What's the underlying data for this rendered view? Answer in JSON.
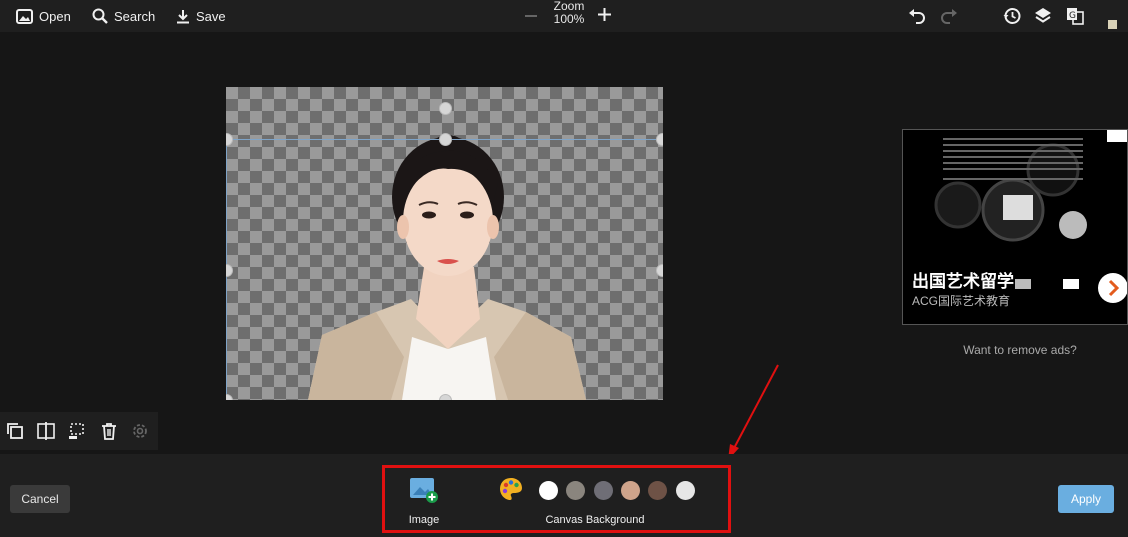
{
  "toolbar": {
    "open_label": "Open",
    "search_label": "Search",
    "save_label": "Save",
    "zoom_title": "Zoom",
    "zoom_value": "100%"
  },
  "icons": [
    "open-image-icon",
    "search-icon",
    "download-icon",
    "minus-icon",
    "plus-icon",
    "undo-icon",
    "redo-icon",
    "history-icon",
    "layers-icon",
    "translate-icon",
    "duplicate-icon",
    "flip-icon",
    "crop-icon",
    "trash-icon",
    "gear-icon",
    "add-image-icon",
    "palette-icon",
    "chevron-right-icon"
  ],
  "ad": {
    "title": "出国艺术留学",
    "subtitle": "ACG国际艺术教育",
    "remove_ads": "Want to remove ads?"
  },
  "bottom": {
    "cancel_label": "Cancel",
    "apply_label": "Apply",
    "image_label": "Image",
    "canvas_background_label": "Canvas Background",
    "swatches": [
      "#ffffff",
      "#8a857e",
      "#6f6e76",
      "#cfa48b",
      "#6e5246",
      "#e6e6e6"
    ]
  },
  "colors": {
    "accent_apply": "#6aaee0",
    "highlight_box": "#e01010"
  }
}
